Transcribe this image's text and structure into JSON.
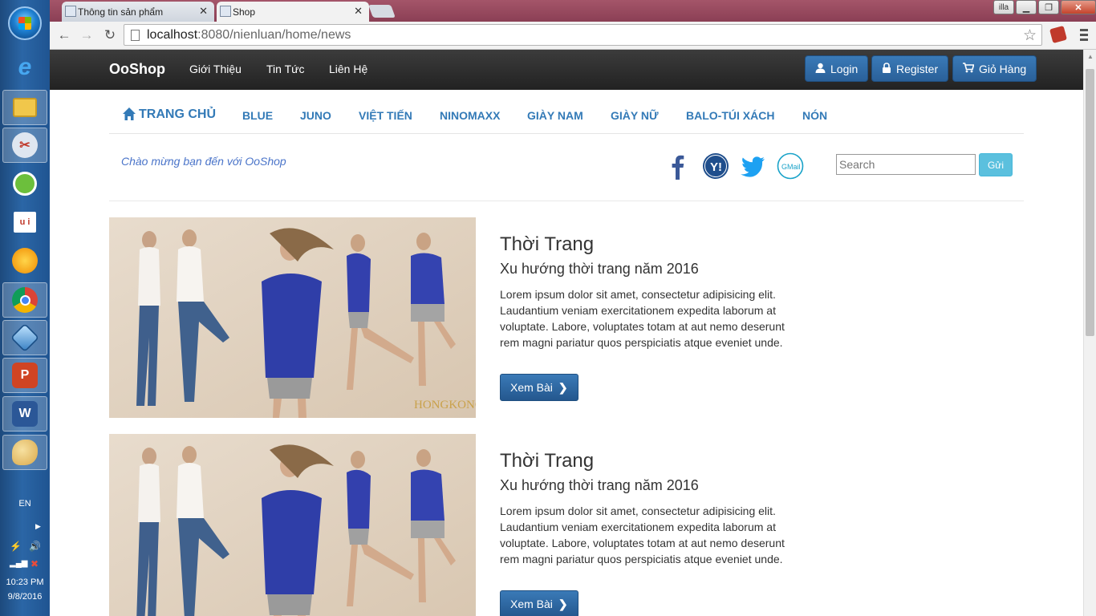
{
  "taskbar": {
    "lang": "EN",
    "time": "10:23 PM",
    "date": "9/8/2016"
  },
  "browser": {
    "tabs": [
      {
        "label": "Thông tin sản phẩm"
      },
      {
        "label": "Shop"
      }
    ],
    "window_user": "illa",
    "url_host": "localhost",
    "url_path": ":8080/nienluan/home/news"
  },
  "navbar": {
    "brand": "OoShop",
    "links": [
      "Giới Thiệu",
      "Tin Tức",
      "Liên Hệ"
    ],
    "login": "Login",
    "register": "Register",
    "cart": "Giỏ Hàng"
  },
  "categories": [
    "TRANG CHỦ",
    "BLUE",
    "JUNO",
    "VIỆT TIẾN",
    "NINOMAXX",
    "GIÀY NAM",
    "GIÀY NỮ",
    "BALO-TÚI XÁCH",
    "NÓN"
  ],
  "welcome": "Chào mừng bạn đến với OoShop",
  "social": [
    "facebook-icon",
    "yahoo-icon",
    "twitter-icon",
    "gmail-icon"
  ],
  "search": {
    "placeholder": "Search",
    "button": "Gửi"
  },
  "articles": [
    {
      "title": "Thời Trang",
      "subtitle": "Xu hướng thời trang năm 2016",
      "body": "Lorem ipsum dolor sit amet, consectetur adipisicing elit. Laudantium veniam exercitationem expedita laborum at voluptate. Labore, voluptates totam at aut nemo deserunt rem magni pariatur quos perspiciatis atque eveniet unde.",
      "button": "Xem Bài",
      "watermark": "HONGKONG"
    },
    {
      "title": "Thời Trang",
      "subtitle": "Xu hướng thời trang năm 2016",
      "body": "Lorem ipsum dolor sit amet, consectetur adipisicing elit. Laudantium veniam exercitationem expedita laborum at voluptate. Labore, voluptates totam at aut nemo deserunt rem magni pariatur quos perspiciatis atque eveniet unde.",
      "button": "Xem Bài"
    }
  ]
}
